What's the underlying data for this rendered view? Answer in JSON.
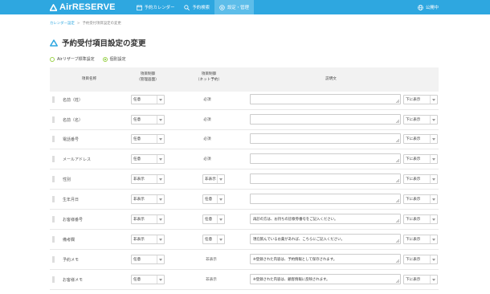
{
  "header": {
    "logo": "AirRESERVE",
    "nav": [
      {
        "label": "予約カレンダー",
        "icon": "calendar-icon"
      },
      {
        "label": "予約検索",
        "icon": "search-icon"
      },
      {
        "label": "設定・管理",
        "icon": "gear-icon"
      }
    ],
    "status_label": "公開中"
  },
  "breadcrumb": {
    "link": "カレンダー設定",
    "sep": ">",
    "current": "予約受付項目設定の変更"
  },
  "page_title": "予約受付項目設定の変更",
  "mode": {
    "option1": "Airリザーブ標準設定",
    "option2": "個別設定"
  },
  "table": {
    "headers": {
      "name": "項目名称",
      "mgmt": "項目制御\n（管理画面）",
      "net": "項目制御\n（ネット予約）",
      "desc": "説明文"
    },
    "rows": [
      {
        "name": "名前（姓）",
        "mgmt": "任意",
        "net_text": "必須",
        "desc": "",
        "pos": "下に表示"
      },
      {
        "name": "名前（名）",
        "mgmt": "任意",
        "net_text": "必須",
        "desc": "",
        "pos": "下に表示"
      },
      {
        "name": "電話番号",
        "mgmt": "任意",
        "net_text": "必須",
        "desc": "",
        "pos": "下に表示"
      },
      {
        "name": "メールアドレス",
        "mgmt": "任意",
        "net_text": "必須",
        "desc": "",
        "pos": "下に表示"
      },
      {
        "name": "性別",
        "mgmt": "非表示",
        "net_select": "非表示",
        "desc": "",
        "pos": "下に表示"
      },
      {
        "name": "生年月日",
        "mgmt": "非表示",
        "net_select": "任意",
        "desc": "",
        "pos": "下に表示"
      },
      {
        "name": "お客様番号",
        "mgmt": "非表示",
        "net_select": "任意",
        "desc": "再診の方は、お持ちの診察券番号をご記入ください。",
        "pos": "下に表示"
      },
      {
        "name": "備考欄",
        "mgmt": "非表示",
        "net_select": "任意",
        "desc": "現在飲んでいるお薬があれば、こちらにご記入ください。",
        "pos": "下に表示"
      },
      {
        "name": "予約メモ",
        "mgmt": "任意",
        "net_text": "非表示",
        "desc": "※登録された内容は、予約情報として保存されます。",
        "pos": "下に表示"
      },
      {
        "name": "お客様メモ",
        "mgmt": "任意",
        "net_text": "非表示",
        "desc": "※登録された内容は、顧客情報に反映されます。",
        "pos": "下に表示"
      }
    ]
  },
  "colors": {
    "brand": "#2ea7e0",
    "radio": "#7cc63a"
  }
}
